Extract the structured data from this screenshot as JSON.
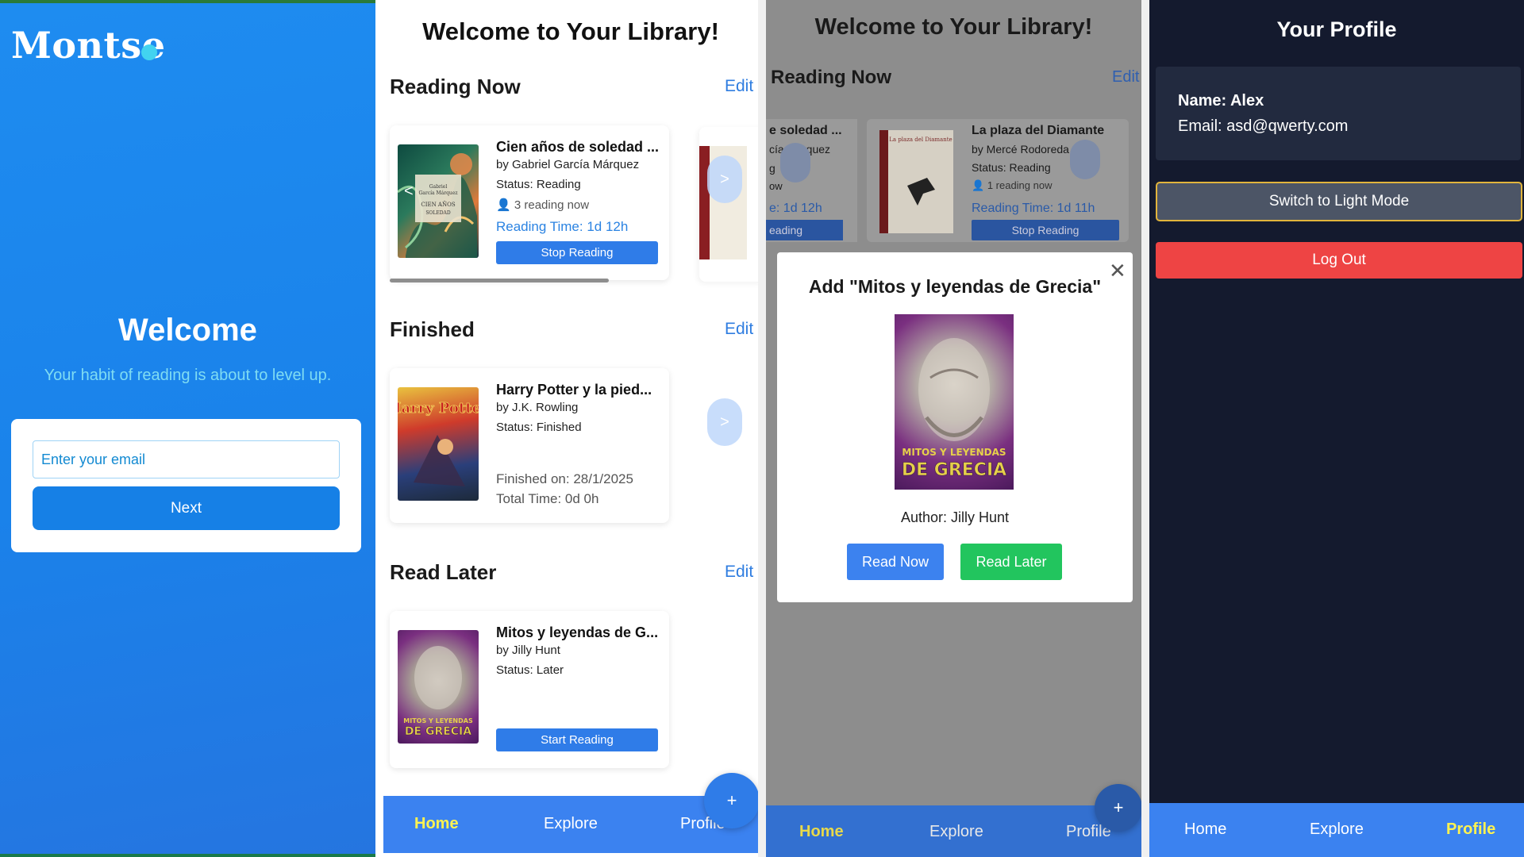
{
  "welcome": {
    "logo": "Montse",
    "title": "Welcome",
    "subtitle": "Your habit of reading is about to level up.",
    "email_placeholder": "Enter your email",
    "next_label": "Next"
  },
  "library": {
    "title": "Welcome to Your Library!",
    "edit_label": "Edit",
    "reading_now": {
      "heading": "Reading Now",
      "book": {
        "title": "Cien años de soledad ...",
        "author": "by Gabriel García Márquez",
        "status": "Status: Reading",
        "readers": "3 reading now",
        "reading_time": "Reading Time: 1d 12h",
        "button": "Stop Reading",
        "cover_text": "Gabriel García Márquez CIEN AÑOS DE SOLEDAD"
      },
      "next_arrow": ">",
      "prev_arrow": "<"
    },
    "finished": {
      "heading": "Finished",
      "book": {
        "title": "Harry Potter y la pied...",
        "author": "by J.K. Rowling",
        "status": "Status: Finished",
        "finished_on": "Finished on: 28/1/2025",
        "total_time": "Total Time: 0d 0h",
        "cover_text": "Harry Potter"
      },
      "next_arrow": ">"
    },
    "read_later": {
      "heading": "Read Later",
      "book": {
        "title": "Mitos y leyendas de G...",
        "author": "by Jilly Hunt",
        "status": "Status: Later",
        "button": "Start Reading",
        "cover_text": "MITOS Y LEYENDAS DE GRECIA"
      }
    },
    "fab": "+",
    "nav": {
      "home": "Home",
      "explore": "Explore",
      "profile": "Profile"
    }
  },
  "modal_screen": {
    "title": "Welcome to Your Library!",
    "reading_now": "Reading Now",
    "edit": "Edit",
    "left_book": {
      "title": "e soledad ...",
      "author": "cía Márquez",
      "status_frag": "g",
      "readers_frag": "ow",
      "time": "e: 1d 12h",
      "btn": "eading"
    },
    "right_book": {
      "title": "La plaza del Diamante",
      "author": "by Mercé Rodoreda",
      "status": "Status: Reading",
      "readers": "1 reading now",
      "reading_time": "Reading Time: 1d 11h",
      "button": "Stop Reading",
      "cover_text": "La plaza del Diamante"
    },
    "modal": {
      "title": "Add \"Mitos y leyendas de Grecia\"",
      "author": "Author: Jilly Hunt",
      "read_now": "Read Now",
      "read_later": "Read Later",
      "close": "✕"
    },
    "fab": "+",
    "nav": {
      "home": "Home",
      "explore": "Explore",
      "profile": "Profile"
    }
  },
  "profile": {
    "title": "Your Profile",
    "name": "Name: Alex",
    "email": "Email: asd@qwerty.com",
    "toggle": "Switch to Light Mode",
    "logout": "Log Out",
    "nav": {
      "home": "Home",
      "explore": "Explore",
      "profile": "Profile"
    }
  },
  "colors": {
    "brand_blue": "#1680e6",
    "accent_yellow": "#fff350",
    "danger_red": "#ee4444",
    "reader_green": "#22c55e",
    "dark_bg": "#141a2e"
  }
}
